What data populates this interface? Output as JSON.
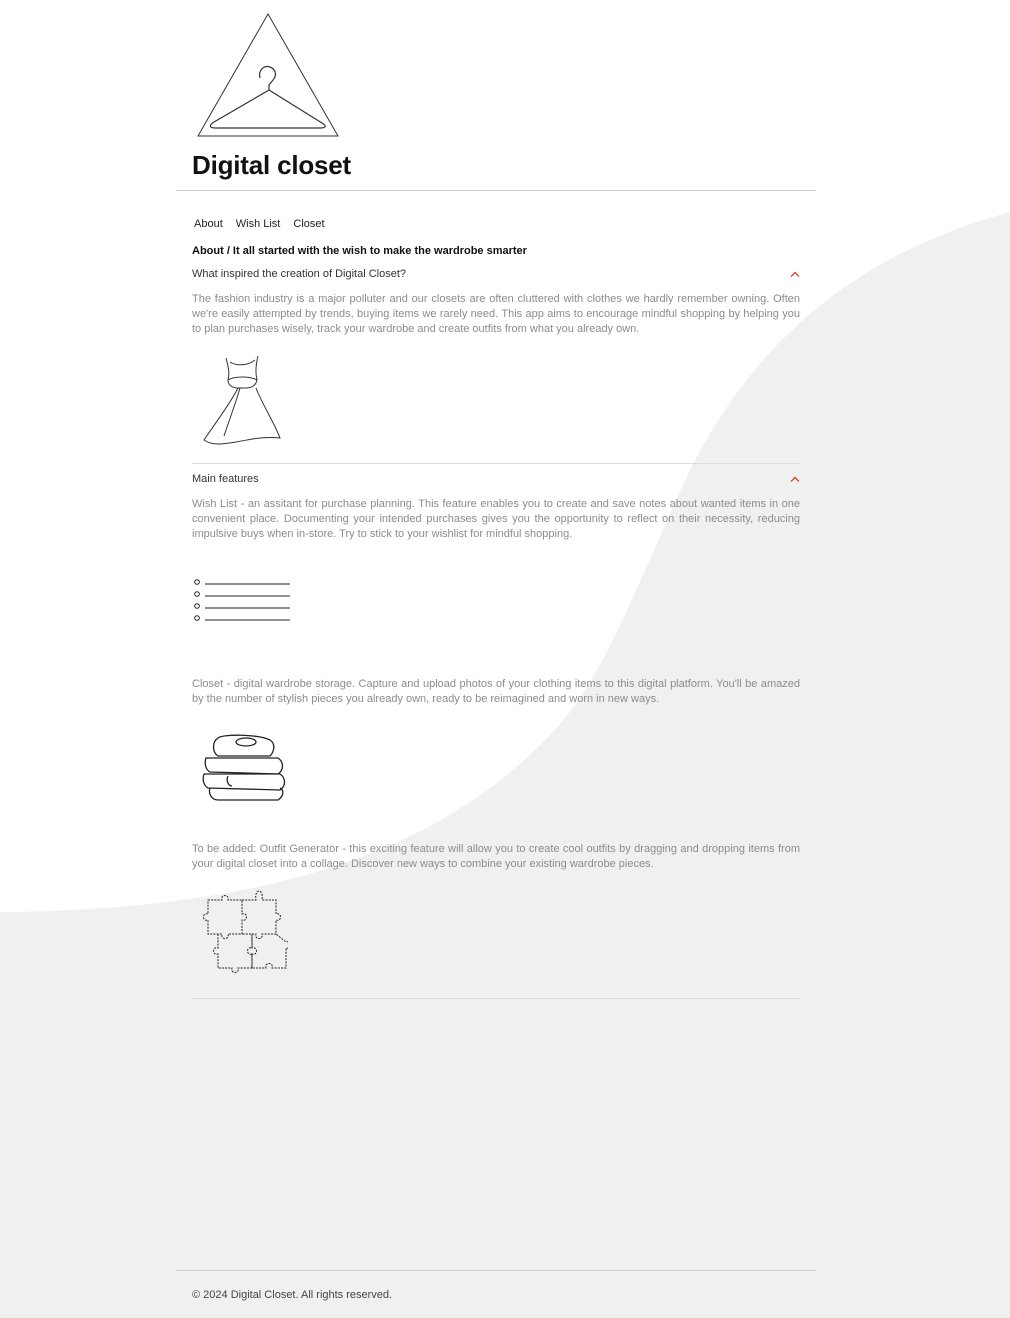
{
  "header": {
    "logo_icon": "hanger-triangle-logo-icon",
    "title": "Digital closet"
  },
  "nav": [
    {
      "label": "About"
    },
    {
      "label": "Wish List"
    },
    {
      "label": "Closet"
    }
  ],
  "breadcrumb": "About / It all started with the wish to make the wardrobe smarter",
  "sections": [
    {
      "header": "What inspired the creation of Digital Closet?",
      "expanded": true,
      "paragraph": "The fashion industry is a major polluter and our closets are often cluttered with clothes we hardly remember owning. Often we're easily attempted by trends, buying items we rarely need. This app aims to encourage mindful shopping by helping you to plan purchases wisely, track your wardrobe and create outfits from what you already own.",
      "illustration": "dress-icon"
    },
    {
      "header": "Main features",
      "expanded": true,
      "features": [
        {
          "paragraph": "Wish List - an assitant for purchase planning. This feature enables you to create and save notes about wanted items in one convenient place. Documenting your intended purchases gives you the opportunity to reflect on their necessity, reducing impulsive buys when in-store. Try to stick to your wishlist for mindful shopping.",
          "illustration": "checklist-icon"
        },
        {
          "paragraph": "Closet - digital wardrobe storage. Capture and upload photos of your clothing items to this digital platform. You'll be amazed by the number of stylish pieces you already own, ready to be reimagined and worn in new ways.",
          "illustration": "folded-clothes-icon"
        },
        {
          "paragraph": "To be added: Outfit Generator - this exciting feature will allow you to create cool outfits by dragging and dropping items from your digital closet into a collage. Discover new ways to combine your existing wardrobe pieces.",
          "illustration": "puzzle-pieces-icon"
        }
      ]
    }
  ],
  "colors": {
    "accent": "#e0443a",
    "background_shape": "#f0f0f0",
    "muted_text": "#8c8c8c"
  },
  "footer": {
    "copyright": "© 2024 Digital Closet. All rights reserved."
  }
}
